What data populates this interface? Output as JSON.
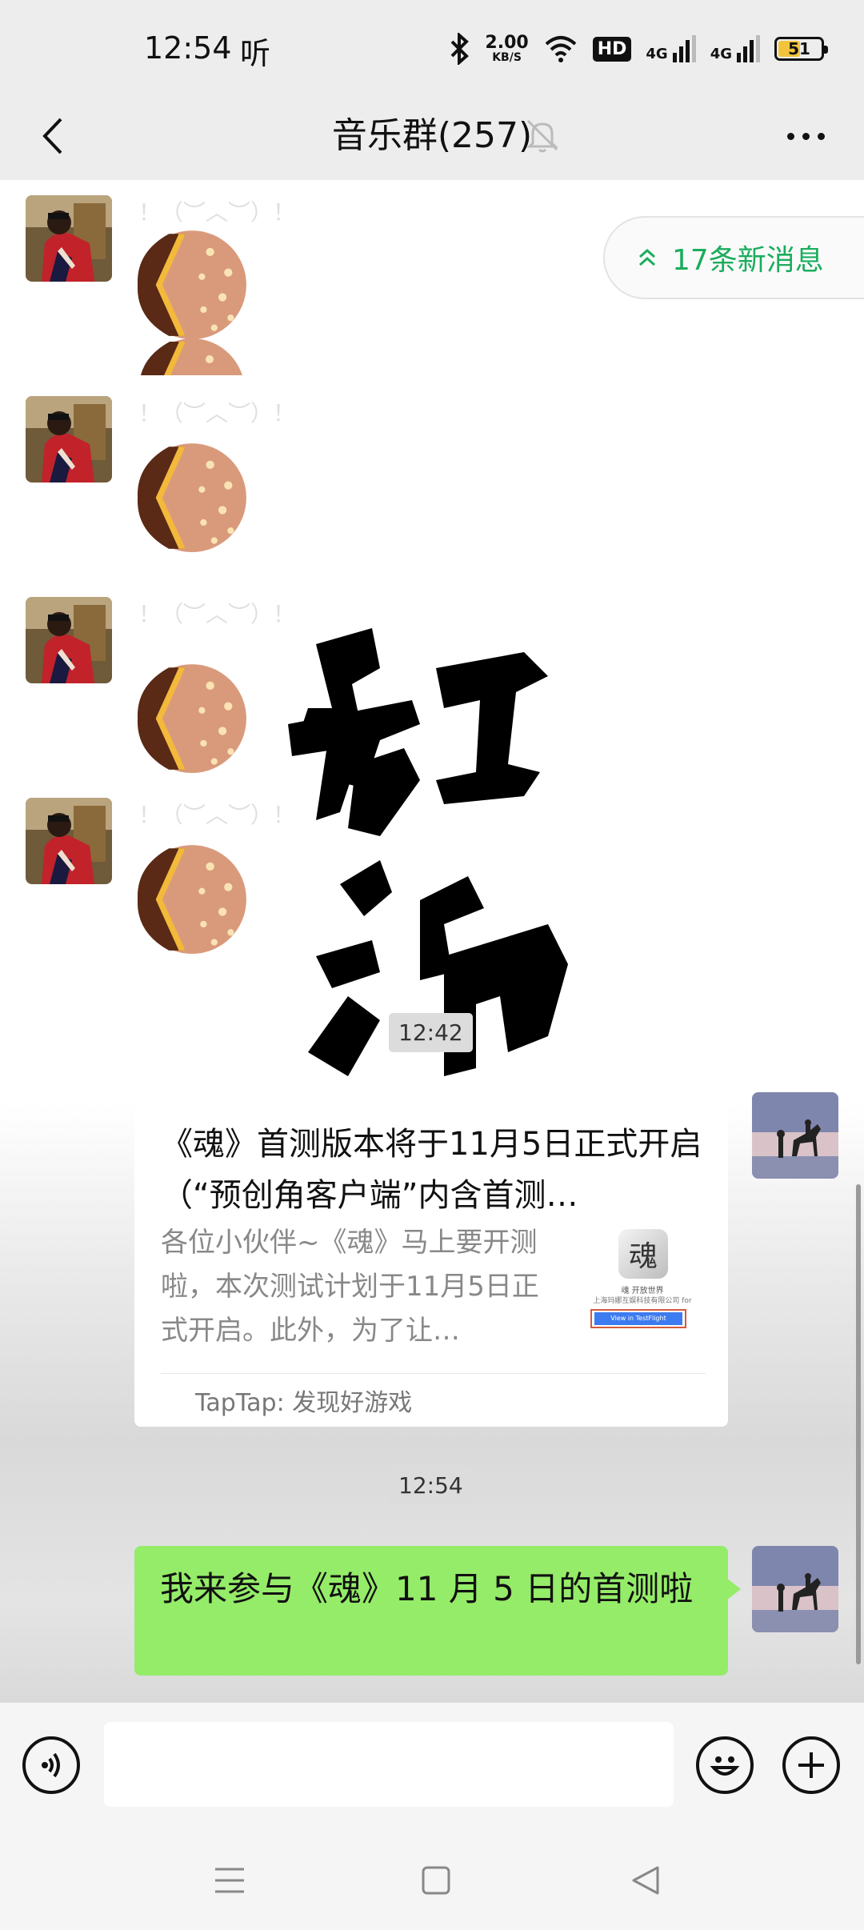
{
  "status": {
    "time": "12:54",
    "ting": "听",
    "speed_value": "2.00",
    "speed_unit": "KB/S",
    "hd": "HD",
    "net1": "4G",
    "net2": "4G",
    "battery": "51",
    "battery_level": 0.51
  },
  "header": {
    "title": "音乐群(257)"
  },
  "new_messages": {
    "label": "17条新消息"
  },
  "stickers": {
    "caption": "！（︶︿︶）！"
  },
  "timestamps": [
    "12:42",
    "12:54"
  ],
  "link_card": {
    "title": "《魂》首测版本将于11月5日正式开启（“预创角客户端”内含首测…",
    "description": "各位小伙伴~《魂》马上要开测啦，本次测试计划于11月5日正式开启。此外，为了让…",
    "source": "TapTap: 发现好游戏",
    "thumb_title": "魂",
    "thumb_caption": "魂 开放世界",
    "thumb_company": "上海玛娜互娱科技有限公司 for",
    "thumb_button": "View in TestFlight"
  },
  "my_message": {
    "text": "我来参与《魂》11 月 5 日的首测啦"
  },
  "input": {
    "value": "",
    "placeholder": ""
  },
  "colors": {
    "bar_bg": "#ededed",
    "bubble_green": "#95ec69",
    "accent_green": "#1aad5c"
  }
}
